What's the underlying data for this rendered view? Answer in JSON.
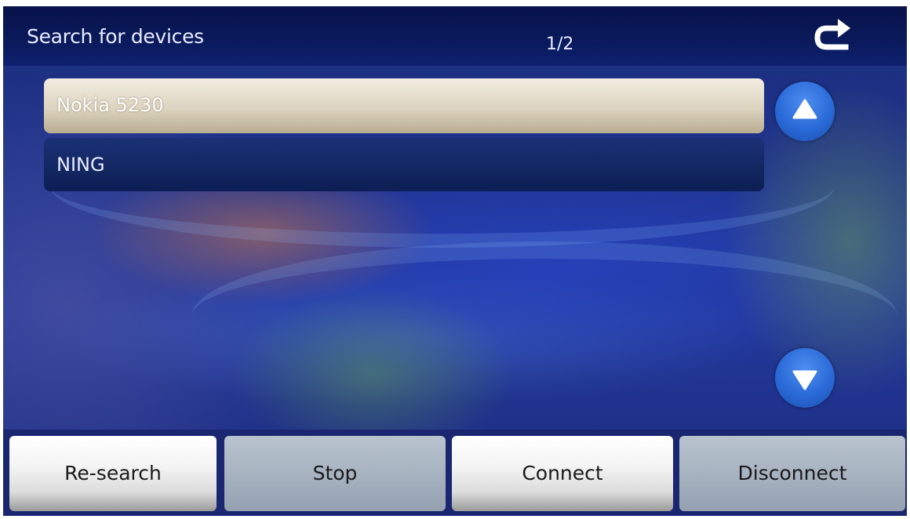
{
  "header": {
    "title": "Search for devices",
    "page_indicator": "1/2",
    "back_icon": "back-arrow-icon"
  },
  "devices": [
    {
      "name": "Nokia 5230",
      "selected": true
    },
    {
      "name": "NING",
      "selected": false
    }
  ],
  "scroll": {
    "up_icon": "arrow-up-icon",
    "down_icon": "arrow-down-icon"
  },
  "buttons": {
    "research": "Re-search",
    "stop": "Stop",
    "connect": "Connect",
    "disconnect": "Disconnect"
  },
  "colors": {
    "header": "#0a1a5c",
    "selected_row": "#dcd4c0",
    "row": "#122660",
    "scroll_button": "#2a6ad8",
    "button_grey": "#a6b1bf"
  }
}
